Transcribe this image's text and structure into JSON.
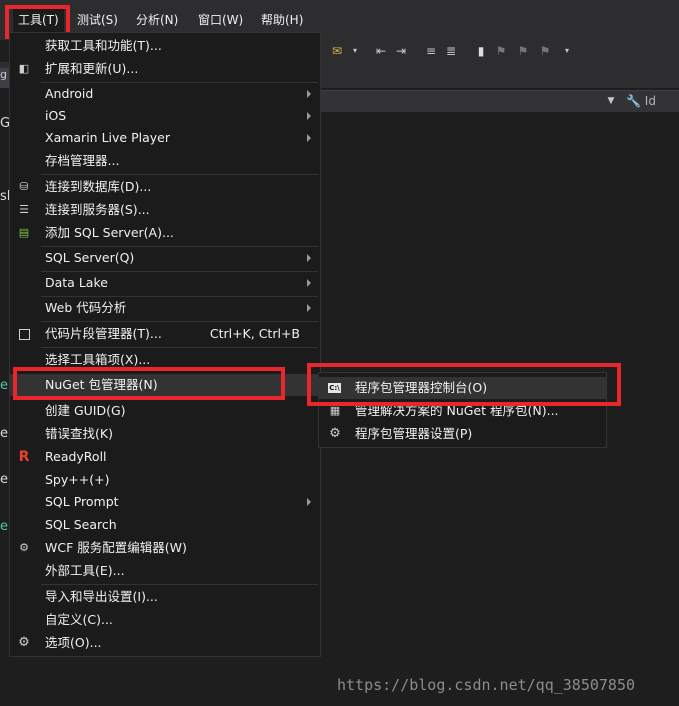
{
  "menubar": {
    "items": [
      "工具(T)",
      "测试(S)",
      "分析(N)",
      "窗口(W)",
      "帮助(H)"
    ]
  },
  "editor": {
    "left_fragments": [
      "g",
      "G",
      "sl",
      "e",
      "e",
      "e",
      "e"
    ],
    "nav_field": "Id"
  },
  "tools_menu": {
    "items": [
      {
        "label": "获取工具和功能(T)..."
      },
      {
        "label": "扩展和更新(U)..."
      },
      {
        "label": "Android"
      },
      {
        "label": "iOS"
      },
      {
        "label": "Xamarin Live Player"
      },
      {
        "label": "存档管理器..."
      },
      {
        "label": "连接到数据库(D)..."
      },
      {
        "label": "连接到服务器(S)..."
      },
      {
        "label": "添加 SQL Server(A)..."
      },
      {
        "label": "SQL Server(Q)"
      },
      {
        "label": "Data Lake"
      },
      {
        "label": "Web 代码分析"
      },
      {
        "label": "代码片段管理器(T)...",
        "shortcut": "Ctrl+K, Ctrl+B"
      },
      {
        "label": "选择工具箱项(X)..."
      },
      {
        "label": "NuGet 包管理器(N)"
      },
      {
        "label": "创建 GUID(G)"
      },
      {
        "label": "错误查找(K)"
      },
      {
        "label": "ReadyRoll"
      },
      {
        "label": "Spy++(+)"
      },
      {
        "label": "SQL Prompt"
      },
      {
        "label": "SQL Search"
      },
      {
        "label": "WCF 服务配置编辑器(W)"
      },
      {
        "label": "外部工具(E)..."
      },
      {
        "label": "导入和导出设置(I)..."
      },
      {
        "label": "自定义(C)..."
      },
      {
        "label": "选项(O)..."
      }
    ]
  },
  "nuget_submenu": {
    "items": [
      {
        "label": "程序包管理器控制台(O)",
        "icon_text": "C:\\"
      },
      {
        "label": "管理解决方案的 NuGet 程序包(N)..."
      },
      {
        "label": "程序包管理器设置(P)"
      }
    ]
  },
  "watermark": "https://blog.csdn.net/qq_38507850",
  "colors": {
    "highlight_box": "#e8262b",
    "menu_bg": "#1b1b1c",
    "menubar_bg": "#2d2d30"
  }
}
